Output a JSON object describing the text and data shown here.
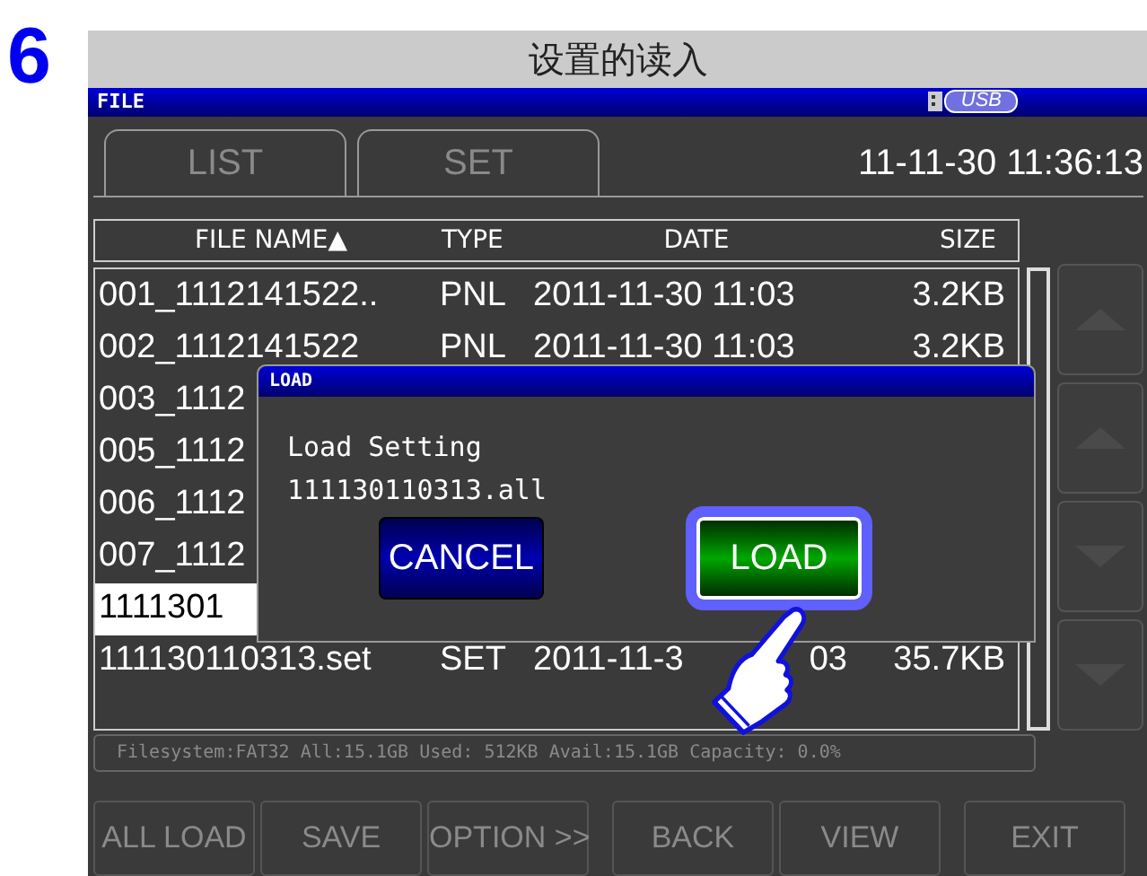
{
  "step": "6",
  "heading": "设置的读入",
  "screen": {
    "title": "FILE",
    "usb": "USB",
    "clock": "11-11-30 11:36:13",
    "tabs": [
      {
        "label": "LIST",
        "selected": false,
        "disabled": true
      },
      {
        "label": "SET",
        "selected": false,
        "disabled": true
      }
    ],
    "table": {
      "columns": [
        "FILE NAME▲",
        "TYPE",
        "DATE",
        "SIZE"
      ],
      "rows": [
        {
          "cells": [
            "001_1112141522..",
            "PNL",
            "2011-11-30 11:03",
            "3.2KB"
          ],
          "selected": false
        },
        {
          "cells": [
            "002_1112141522",
            "PNL",
            "2011-11-30 11:03",
            "3.2KB"
          ],
          "selected": false
        },
        {
          "cells": [
            "003_1112"
          ],
          "selected": false
        },
        {
          "cells": [
            "005_1112"
          ],
          "selected": false
        },
        {
          "cells": [
            "006_1112"
          ],
          "selected": false
        },
        {
          "cells": [
            "007_1112"
          ],
          "selected": false
        },
        {
          "cells": [
            "1111301"
          ],
          "selected": true
        },
        {
          "cells": [
            "111130110313.set",
            "SET",
            "2011-11-3",
            "35.7KB"
          ],
          "date_tail": "03",
          "selected": false
        }
      ]
    },
    "side_buttons": [
      {
        "kind": "up"
      },
      {
        "kind": "up"
      },
      {
        "kind": "down"
      },
      {
        "kind": "down"
      }
    ],
    "status": "Filesystem:FAT32 All:15.1GB Used: 512KB Avail:15.1GB Capacity: 0.0%",
    "buttons": [
      {
        "label": "ALL LOAD",
        "disabled": true
      },
      {
        "label": "SAVE",
        "disabled": true
      },
      {
        "label": "OPTION >>",
        "disabled": true
      },
      {
        "label": "BACK",
        "disabled": true
      },
      {
        "label": "VIEW",
        "disabled": true
      },
      {
        "label": "EXIT",
        "disabled": true
      }
    ],
    "dialog": {
      "title": "LOAD",
      "message": [
        "Load Setting",
        "111130110313.all"
      ],
      "buttons": [
        {
          "label": "CANCEL",
          "kind": "cancel",
          "focused": false
        },
        {
          "label": "LOAD",
          "kind": "confirm",
          "focused": true
        }
      ]
    }
  }
}
